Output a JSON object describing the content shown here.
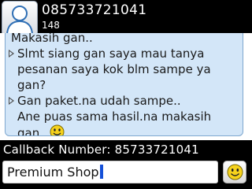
{
  "header": {
    "contact_number": "085733721041",
    "contact_sub": "148",
    "avatar_icon": "contact-avatar-icon"
  },
  "conversation": {
    "lines": [
      {
        "text": "Makasih gan..",
        "arrow": false
      },
      {
        "text": "Slmt siang gan saya mau tanya",
        "arrow": true
      },
      {
        "text": "pesanan saya kok blm sampe ya",
        "arrow": false
      },
      {
        "text": "gan?",
        "arrow": false
      },
      {
        "text": "Gan paket.na udah sampe..",
        "arrow": true
      },
      {
        "text": "Ane puas sama hasil.na makasih",
        "arrow": false
      },
      {
        "text": "gan..",
        "arrow": false,
        "emoticon": "smiley-icon"
      }
    ],
    "bubble_color": "#d3e6f8",
    "arrow_icon": "message-arrow-icon"
  },
  "footer": {
    "callback_label": "Callback Number:",
    "callback_number": "85733721041",
    "compose_value": "Premium Shop",
    "emoticon_button_icon": "smiley-icon"
  },
  "colors": {
    "background": "#000000",
    "caret": "#1550d8",
    "smiley": "#f6d21c"
  }
}
